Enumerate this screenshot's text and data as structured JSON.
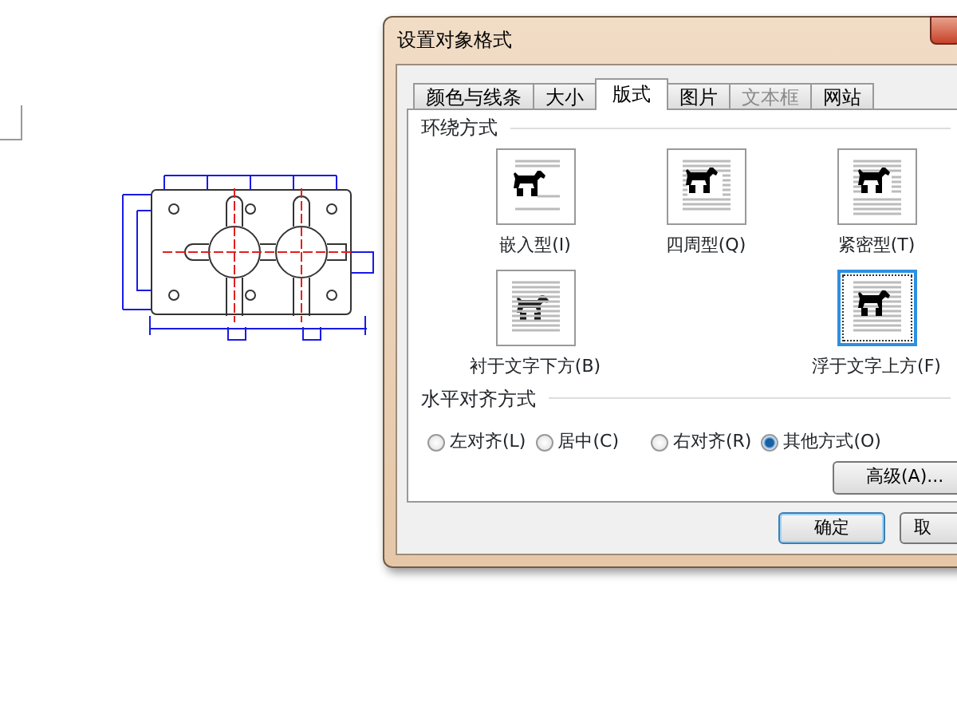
{
  "window": {
    "title": "设置对象格式"
  },
  "tabs": [
    {
      "label": "颜色与线条",
      "selected": false,
      "disabled": false
    },
    {
      "label": "大小",
      "selected": false,
      "disabled": false
    },
    {
      "label": "版式",
      "selected": true,
      "disabled": false
    },
    {
      "label": "图片",
      "selected": false,
      "disabled": false
    },
    {
      "label": "文本框",
      "selected": false,
      "disabled": true
    },
    {
      "label": "网站",
      "selected": false,
      "disabled": false
    }
  ],
  "wrap_section": {
    "title": "环绕方式"
  },
  "wrap_styles": [
    {
      "label": "嵌入型(I)",
      "kind": "inline",
      "selected": false
    },
    {
      "label": "四周型(Q)",
      "kind": "square",
      "selected": false
    },
    {
      "label": "紧密型(T)",
      "kind": "tight",
      "selected": false
    },
    {
      "label": "衬于文字下方(B)",
      "kind": "behind",
      "selected": false
    },
    {
      "label": "浮于文字上方(F)",
      "kind": "front",
      "selected": true
    }
  ],
  "align_section": {
    "title": "水平对齐方式"
  },
  "align_options": [
    {
      "label": "左对齐(L)",
      "selected": false
    },
    {
      "label": "居中(C)",
      "selected": false
    },
    {
      "label": "右对齐(R)",
      "selected": false
    },
    {
      "label": "其他方式(O)",
      "selected": true
    }
  ],
  "advanced_button": "高级(A)...",
  "buttons": [
    "确定",
    "取"
  ]
}
